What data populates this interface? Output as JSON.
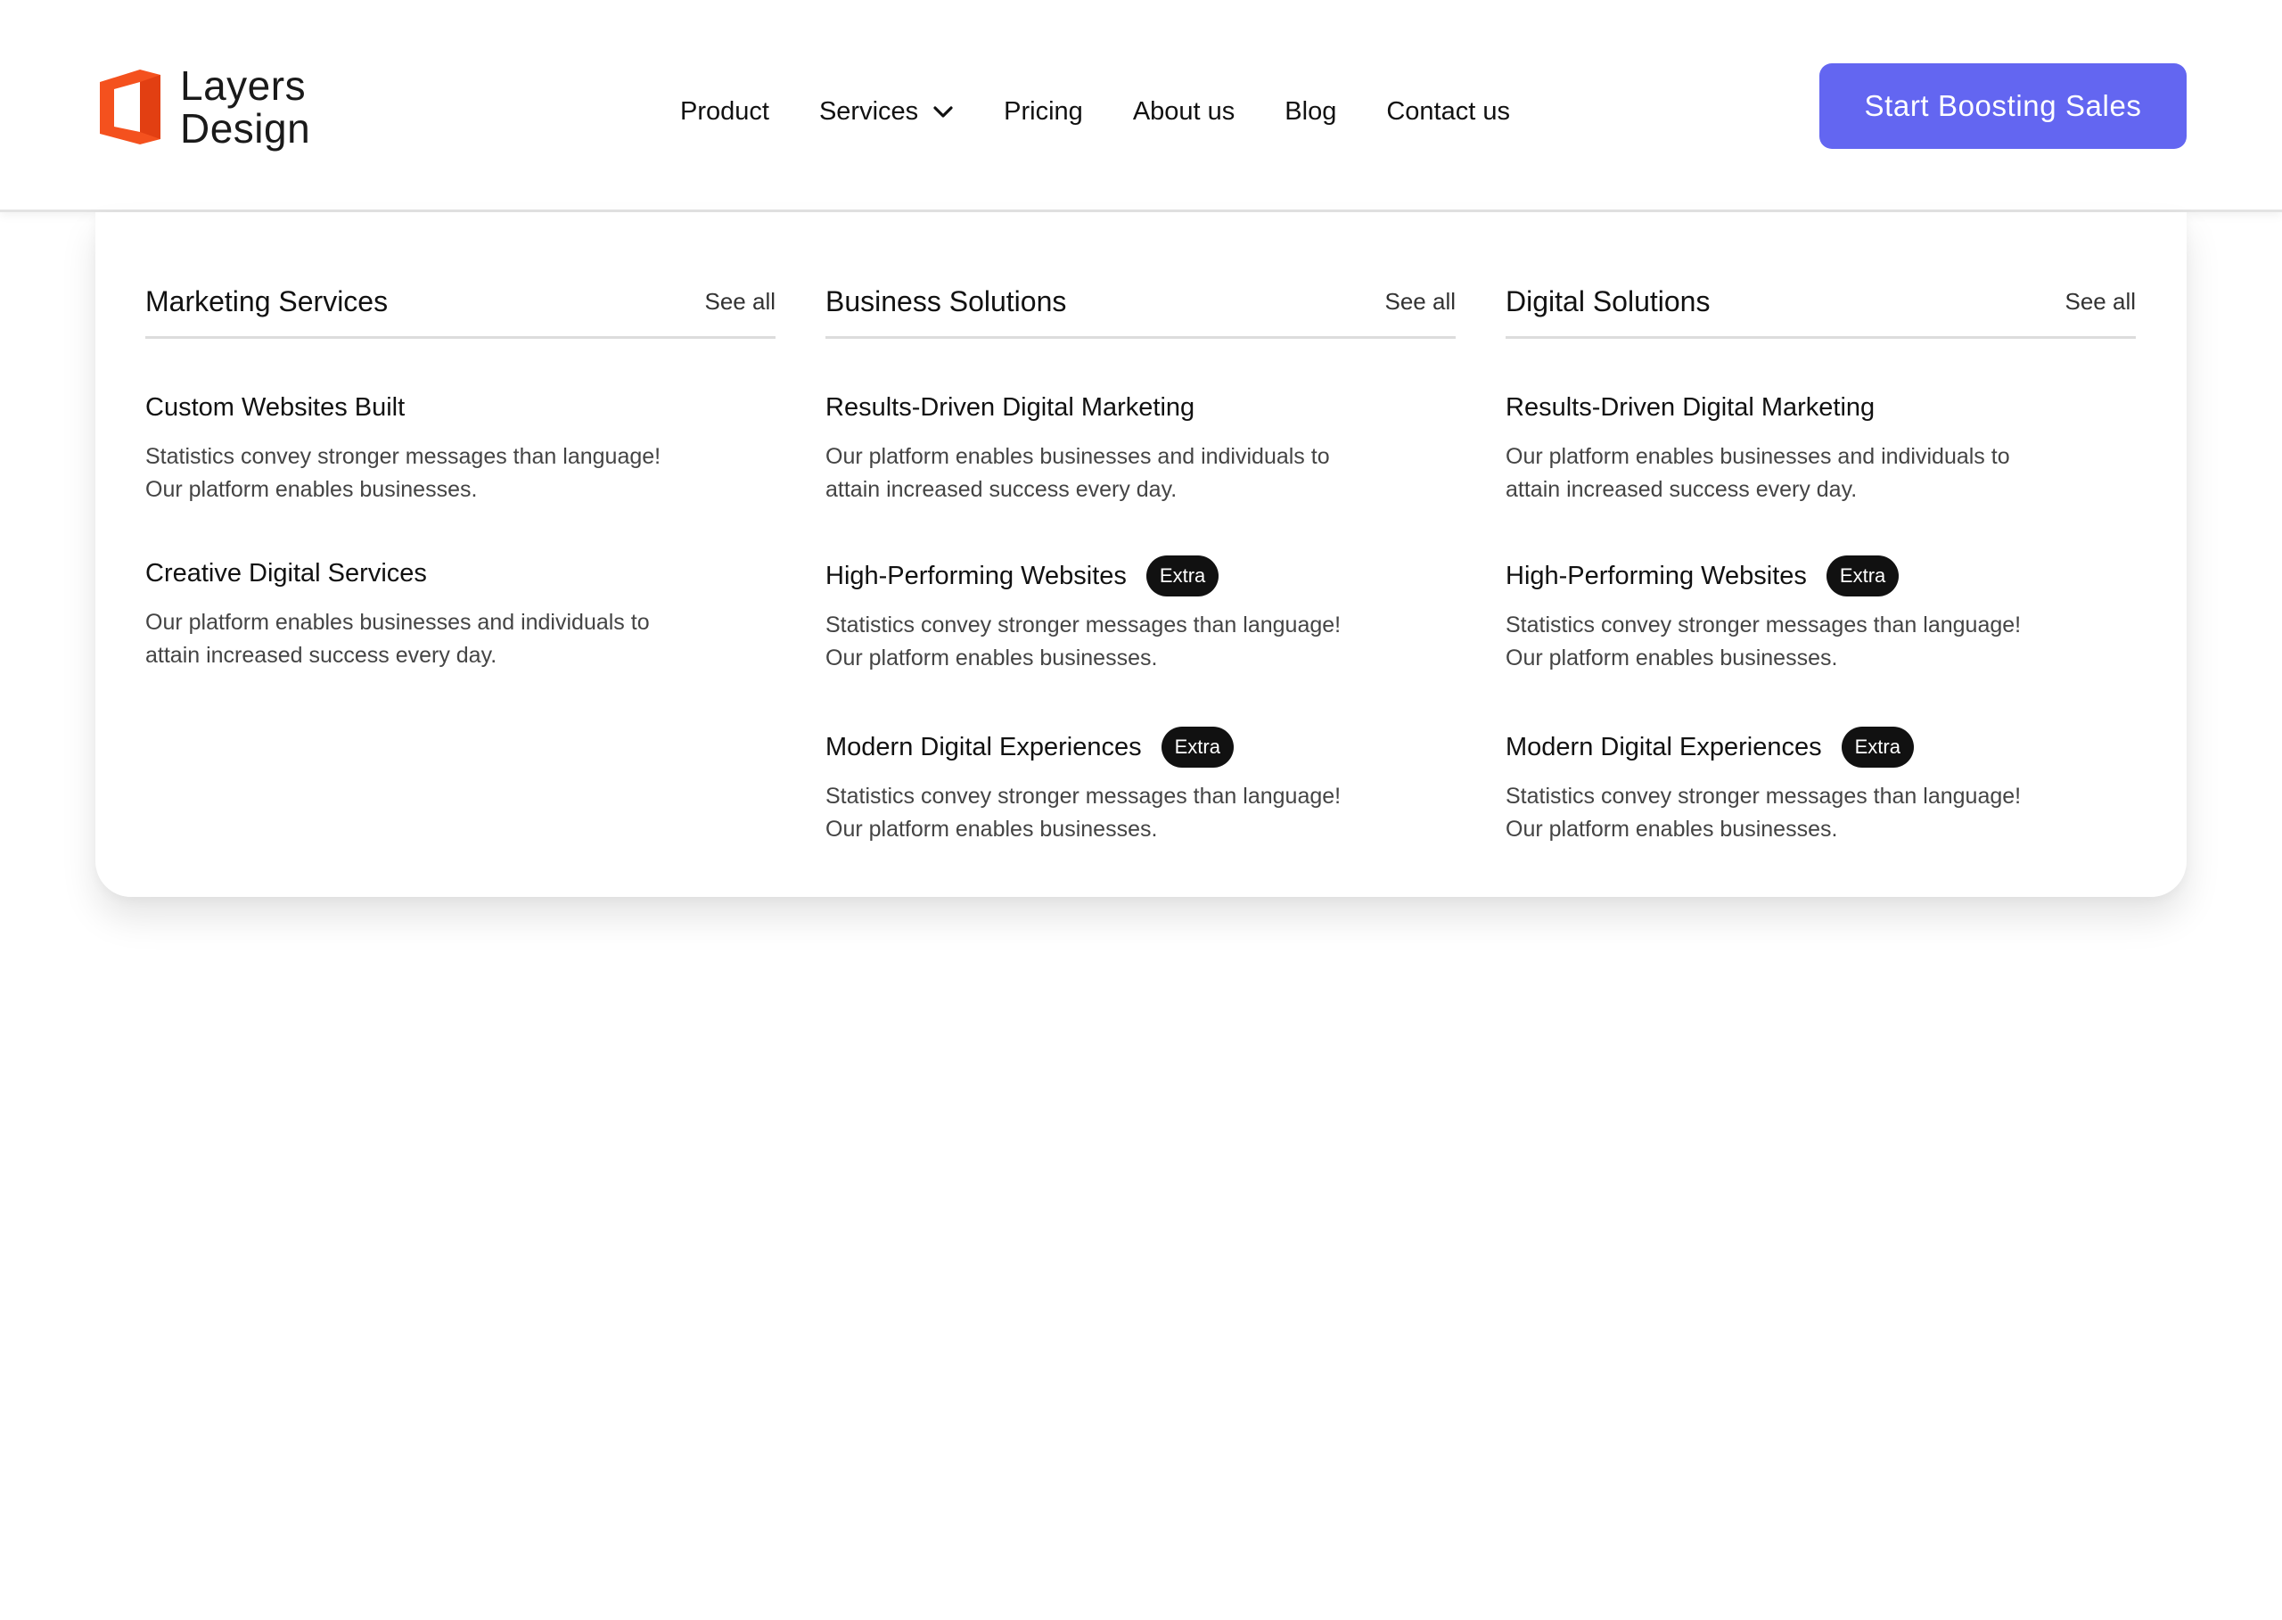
{
  "brand": {
    "name_line1": "Layers",
    "name_line2": "Design",
    "logo_color": "#f4511e"
  },
  "nav": {
    "items": [
      {
        "label": "Product"
      },
      {
        "label": "Services",
        "has_dropdown": true,
        "expanded": true
      },
      {
        "label": "Pricing"
      },
      {
        "label": "About us"
      },
      {
        "label": "Blog"
      },
      {
        "label": "Contact us"
      }
    ]
  },
  "cta": {
    "label": "Start Boosting Sales",
    "color": "#6366f1"
  },
  "mega_menu": {
    "columns": [
      {
        "title": "Marketing Services",
        "see_all": "See all",
        "items": [
          {
            "title": "Custom Websites Built",
            "badge": "",
            "description": "Statistics convey stronger messages than language! Our platform enables businesses."
          },
          {
            "title": "Creative Digital Services",
            "badge": "",
            "description": "Our platform enables businesses and individuals to attain increased success every day."
          }
        ]
      },
      {
        "title": "Business Solutions",
        "see_all": "See all",
        "items": [
          {
            "title": "Results-Driven Digital Marketing",
            "badge": "",
            "description": "Our platform enables businesses and individuals to attain increased success every day."
          },
          {
            "title": "High-Performing Websites",
            "badge": "Extra",
            "description": "Statistics convey stronger messages than language! Our platform enables businesses."
          },
          {
            "title": "Modern Digital Experiences",
            "badge": "Extra",
            "description": "Statistics convey stronger messages than language! Our platform enables businesses."
          }
        ]
      },
      {
        "title": "Digital Solutions",
        "see_all": "See all",
        "items": [
          {
            "title": "Results-Driven Digital Marketing",
            "badge": "",
            "description": "Our platform enables businesses and individuals to attain increased success every day."
          },
          {
            "title": "High-Performing Websites",
            "badge": "Extra",
            "description": "Statistics convey stronger messages than language! Our platform enables businesses."
          },
          {
            "title": "Modern Digital Experiences",
            "badge": "Extra",
            "description": "Statistics convey stronger messages than language! Our platform enables businesses."
          }
        ]
      }
    ]
  }
}
